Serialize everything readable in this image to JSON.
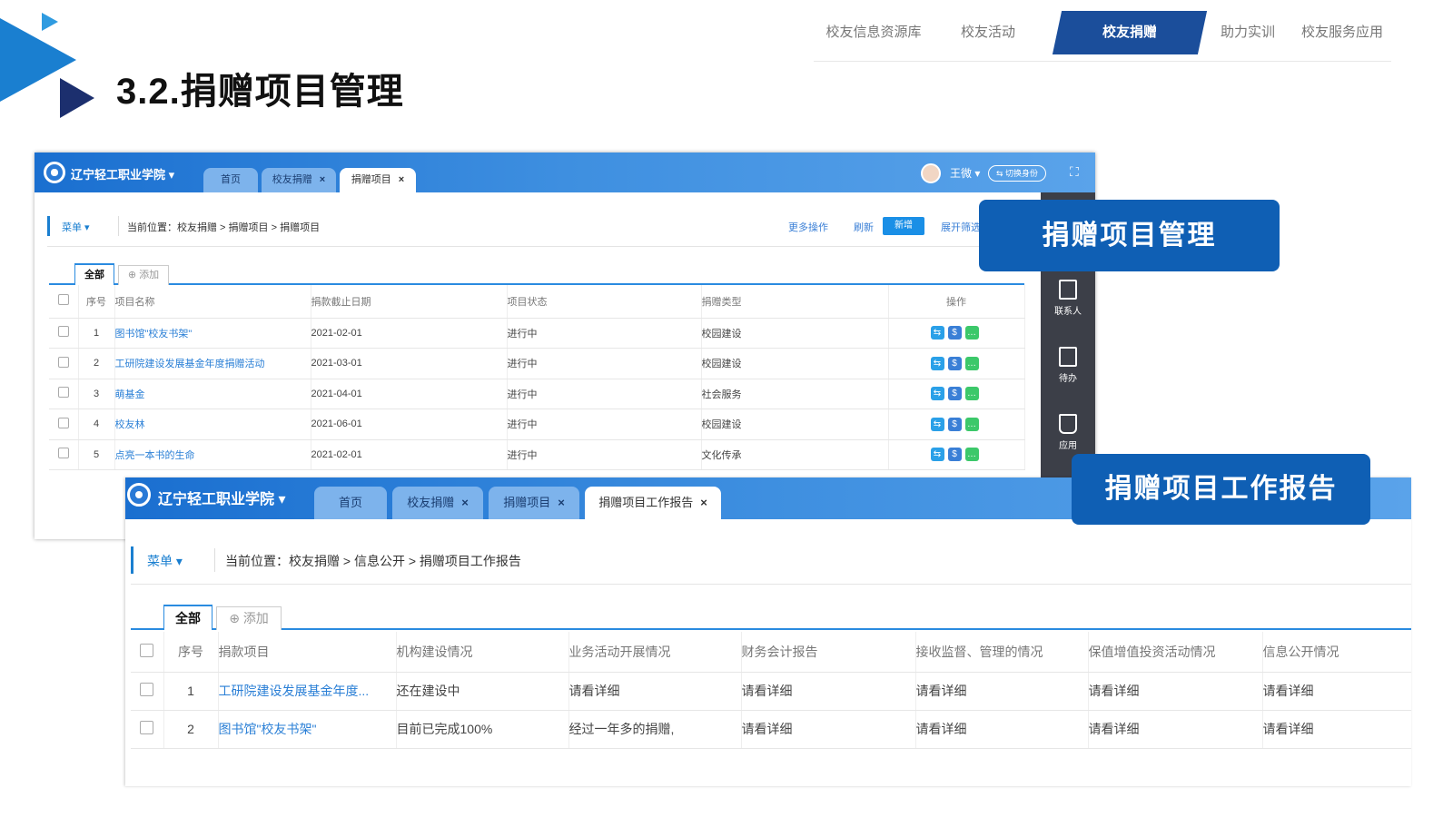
{
  "slide": {
    "title": "3.2.捐赠项目管理",
    "nav": [
      {
        "label": "校友信息资源库",
        "active": false
      },
      {
        "label": "校友活动",
        "active": false
      },
      {
        "label": "校友捐赠",
        "active": true
      },
      {
        "label": "助力实训",
        "active": false
      },
      {
        "label": "校友服务应用",
        "active": false
      }
    ],
    "callouts": [
      "捐赠项目管理",
      "捐赠项目工作报告"
    ]
  },
  "screen1": {
    "school_name": "辽宁轻工职业学院",
    "tabs": [
      "首页",
      "校友捐赠",
      "捐赠项目"
    ],
    "user": {
      "name": "王微",
      "switch_label": "⇆ 切换身份"
    },
    "menu_label": "菜单",
    "breadcrumb": "当前位置：校友捐赠 > 捐赠项目 > 捐赠项目",
    "actions": {
      "more": "更多操作",
      "refresh": "刷新",
      "new": "新增",
      "expand": "展开筛选"
    },
    "subtabs": {
      "all": "全部",
      "add": "添加"
    },
    "columns": [
      "序号",
      "项目名称",
      "捐款截止日期",
      "项目状态",
      "捐赠类型",
      "操作"
    ],
    "rows": [
      {
        "no": "1",
        "name": "图书馆\"校友书架\"",
        "date": "2021-02-01",
        "status": "进行中",
        "type": "校园建设"
      },
      {
        "no": "2",
        "name": "工研院建设发展基金年度捐赠活动",
        "date": "2021-03-01",
        "status": "进行中",
        "type": "校园建设"
      },
      {
        "no": "3",
        "name": "萌基金",
        "date": "2021-04-01",
        "status": "进行中",
        "type": "社会服务"
      },
      {
        "no": "4",
        "name": "校友林",
        "date": "2021-06-01",
        "status": "进行中",
        "type": "校园建设"
      },
      {
        "no": "5",
        "name": "点亮一本书的生命",
        "date": "2021-02-01",
        "status": "进行中",
        "type": "文化传承"
      }
    ],
    "op_colors": [
      "#2aa0e8",
      "#3a7fd6",
      "#3cc86a"
    ],
    "side_items": [
      "联系人",
      "待办",
      "应用"
    ]
  },
  "screen2": {
    "school_name": "辽宁轻工职业学院",
    "tabs": [
      "首页",
      "校友捐赠",
      "捐赠项目",
      "捐赠项目工作报告"
    ],
    "menu_label": "菜单",
    "breadcrumb": "当前位置：校友捐赠 > 信息公开 > 捐赠项目工作报告",
    "subtabs": {
      "all": "全部",
      "add": "添加"
    },
    "columns": [
      "序号",
      "捐款项目",
      "机构建设情况",
      "业务活动开展情况",
      "财务会计报告",
      "接收监督、管理的情况",
      "保值增值投资活动情况",
      "信息公开情况"
    ],
    "rows": [
      {
        "no": "1",
        "project": "工研院建设发展基金年度...",
        "org": "还在建设中",
        "biz": "请看详细",
        "fin": "请看详细",
        "sup": "请看详细",
        "inv": "请看详细",
        "pub": "请看详细"
      },
      {
        "no": "2",
        "project": "图书馆\"校友书架\"",
        "org": "目前已完成100%",
        "biz": "经过一年多的捐赠,",
        "fin": "请看详细",
        "sup": "请看详细",
        "inv": "请看详细",
        "pub": "请看详细"
      }
    ]
  }
}
